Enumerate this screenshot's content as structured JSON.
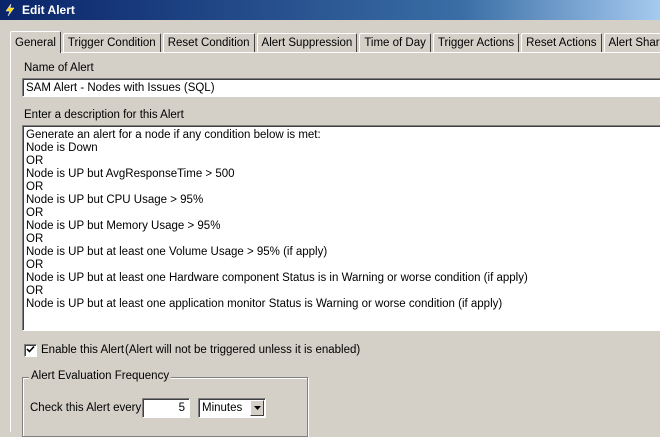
{
  "window": {
    "title": "Edit Alert"
  },
  "tabs": [
    {
      "label": "General",
      "active": true
    },
    {
      "label": "Trigger Condition"
    },
    {
      "label": "Reset Condition"
    },
    {
      "label": "Alert Suppression"
    },
    {
      "label": "Time of Day"
    },
    {
      "label": "Trigger Actions"
    },
    {
      "label": "Reset Actions"
    },
    {
      "label": "Alert Sharing"
    }
  ],
  "general": {
    "name_label": "Name of Alert",
    "name_value": "SAM Alert - Nodes with Issues (SQL)",
    "description_label": "Enter a description for this Alert",
    "description_lines": [
      "Generate an alert for a node if any condition below is met:",
      "Node is Down",
      "OR",
      "Node is UP but AvgResponseTime > 500",
      "OR",
      "Node is UP but CPU Usage > 95%",
      "OR",
      "Node is UP but Memory Usage > 95%",
      "OR",
      "Node is UP but at least one Volume Usage > 95% (if apply)",
      "OR",
      "Node is UP but at least one Hardware component Status is in Warning or worse condition (if apply)",
      "OR",
      "Node is UP but at least one application monitor Status is Warning or worse condition (if apply)"
    ],
    "enable_label": "Enable this Alert",
    "enable_note": "(Alert will not be triggered unless it is enabled)",
    "enable_checked": true
  },
  "evaluation": {
    "group_title": "Alert Evaluation Frequency",
    "check_label": "Check this Alert every",
    "frequency_value": "5",
    "unit_selected": "Minutes"
  },
  "icons": {
    "app": "lightning-icon",
    "check": "checkmark-icon",
    "dropdown": "chevron-down-icon"
  }
}
